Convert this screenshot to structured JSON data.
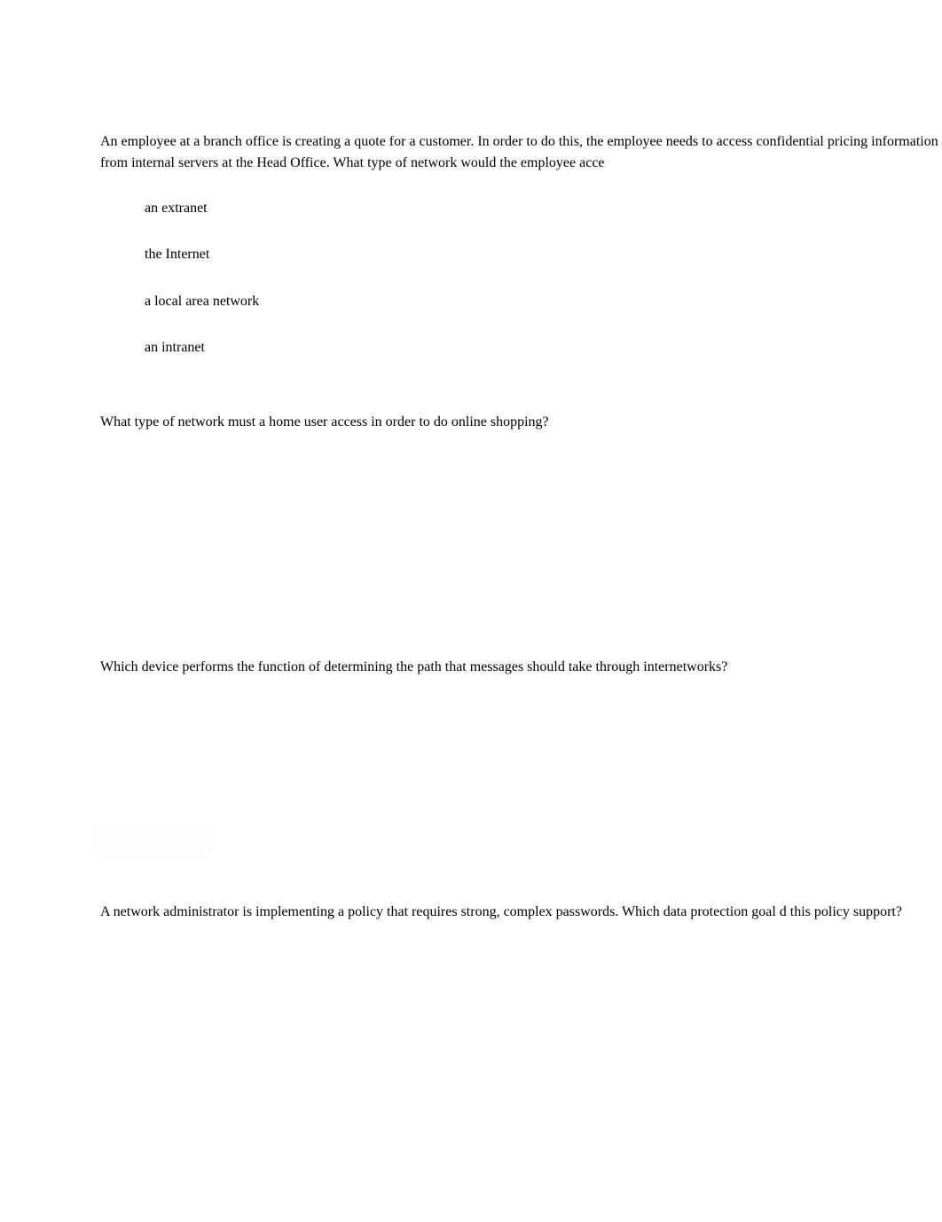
{
  "questions": [
    {
      "text": "An employee at a branch office is creating a quote for a customer. In order to do this, the employee needs to access confidential pricing information from internal servers at the Head Office. What type of network would the employee acce",
      "options": [
        "an extranet",
        "the Internet",
        "a local area network",
        "an intranet"
      ]
    },
    {
      "text": "What type of network must a home user access in order to do online shopping?"
    },
    {
      "text": "Which device performs the function of determining the path that messages should take through internetworks?"
    },
    {
      "text": "A network administrator is implementing a policy that requires strong, complex passwords. Which data protection goal d this policy support?"
    }
  ]
}
